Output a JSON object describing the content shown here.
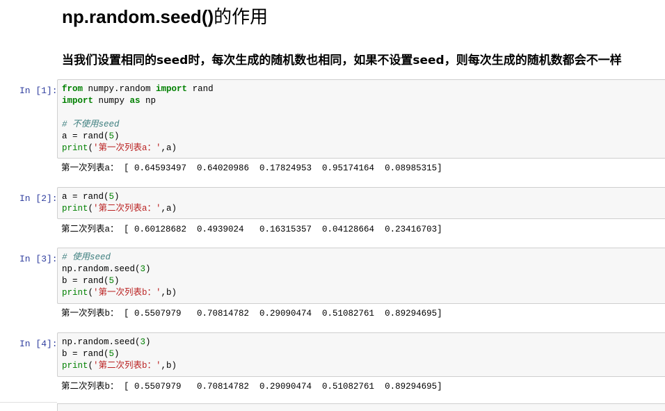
{
  "title": {
    "code": "np.random.seed()",
    "suffix": "的作用"
  },
  "subtitle": "当我们设置相同的seed时，每次生成的随机数也相同，如果不设置seed，则每次生成的随机数都会不一样",
  "cells": [
    {
      "prompt": "In [1]:",
      "code": {
        "l1": {
          "kw1": "from",
          "mod": " numpy.random ",
          "kw2": "import",
          "rest": " rand"
        },
        "l2": {
          "kw1": "import",
          "mod": " numpy ",
          "kw2": "as",
          "rest": " np"
        },
        "l4": "# 不使用seed",
        "l5": {
          "pre": "a = rand(",
          "num": "5",
          "post": ")"
        },
        "l6": {
          "fn": "print",
          "open": "(",
          "str": "'第一次列表a：'",
          "post": ",a)"
        }
      },
      "output": "第一次列表a： [ 0.64593497  0.64020986  0.17824953  0.95174164  0.08985315]"
    },
    {
      "prompt": "In [2]:",
      "code": {
        "l1": {
          "pre": "a = rand(",
          "num": "5",
          "post": ")"
        },
        "l2": {
          "fn": "print",
          "open": "(",
          "str": "'第二次列表a：'",
          "post": ",a)"
        }
      },
      "output": "第二次列表a： [ 0.60128682  0.4939024   0.16315357  0.04128664  0.23416703]"
    },
    {
      "prompt": "In [3]:",
      "code": {
        "l1": "# 使用seed",
        "l2": {
          "pre": "np.random.seed(",
          "num": "3",
          "post": ")"
        },
        "l3": {
          "pre": "b = rand(",
          "num": "5",
          "post": ")"
        },
        "l4": {
          "fn": "print",
          "open": "(",
          "str": "'第一次列表b：'",
          "post": ",b)"
        }
      },
      "output": "第一次列表b： [ 0.5507979   0.70814782  0.29090474  0.51082761  0.89294695]"
    },
    {
      "prompt": "In [4]:",
      "code": {
        "l1": {
          "pre": "np.random.seed(",
          "num": "3",
          "post": ")"
        },
        "l2": {
          "pre": "b = rand(",
          "num": "5",
          "post": ")"
        },
        "l3": {
          "fn": "print",
          "open": "(",
          "str": "'第二次列表b：'",
          "post": ",b)"
        }
      },
      "output": "第二次列表b： [ 0.5507979   0.70814782  0.29090474  0.51082761  0.89294695]"
    }
  ]
}
